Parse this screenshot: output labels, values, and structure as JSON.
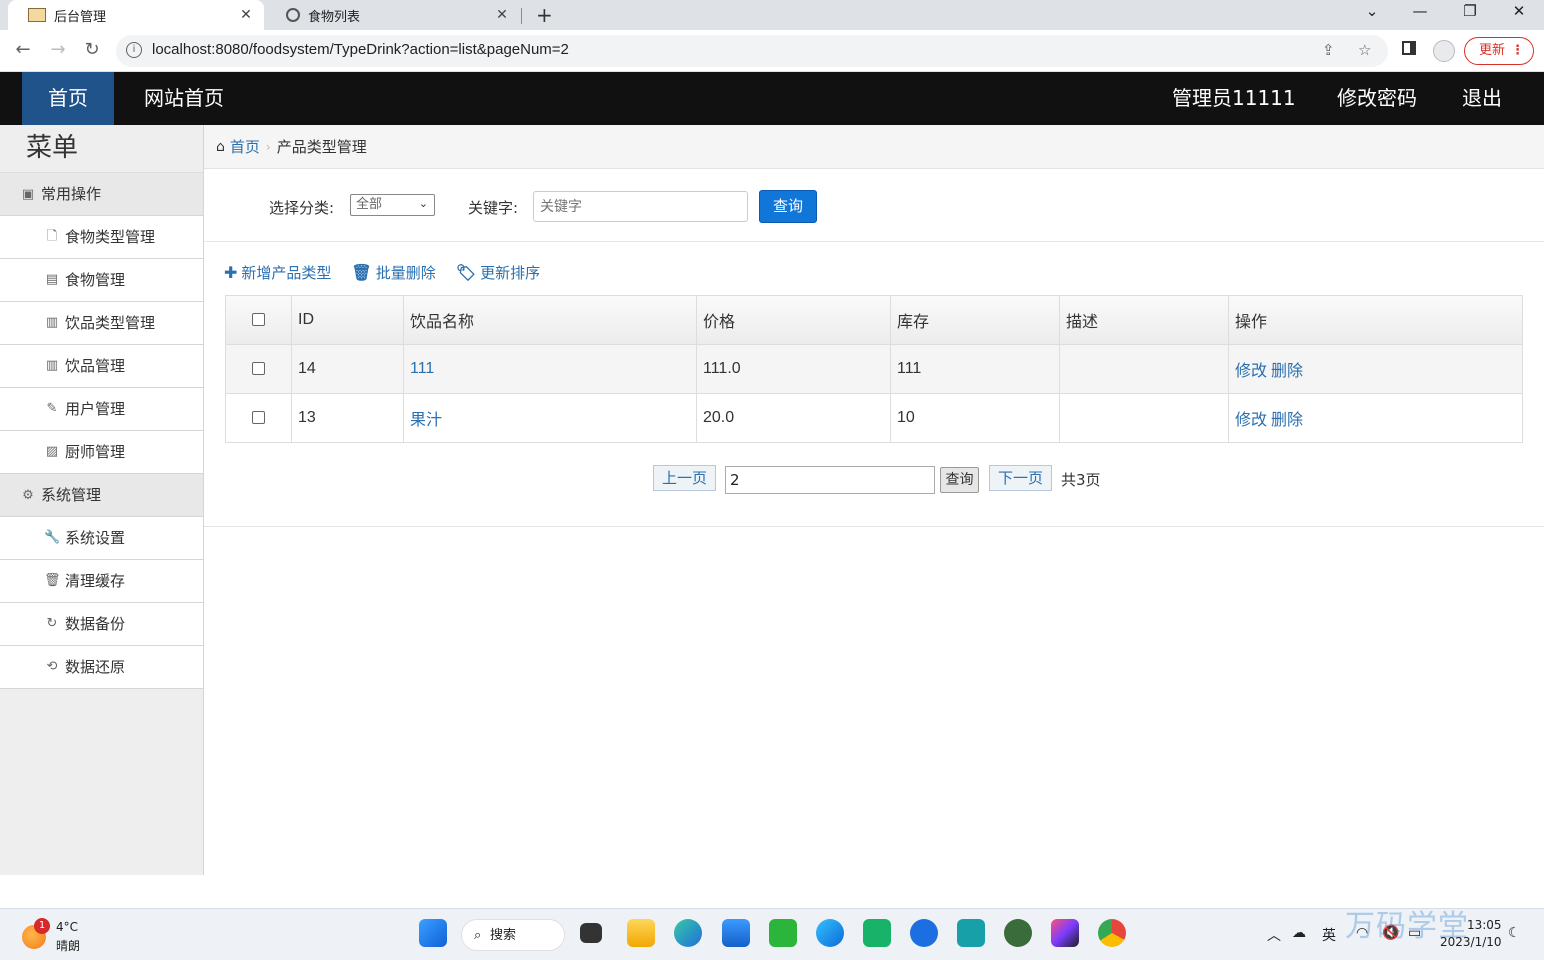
{
  "browser": {
    "tabs": [
      {
        "title": "后台管理",
        "active": true
      },
      {
        "title": "食物列表",
        "active": false
      }
    ],
    "url": "localhost:8080/foodsystem/TypeDrink?action=list&pageNum=2",
    "update_label": "更新"
  },
  "header": {
    "home": "首页",
    "site_home": "网站首页",
    "admin": "管理员11111",
    "change_password": "修改密码",
    "logout": "退出"
  },
  "sidebar": {
    "title": "菜单",
    "groups": [
      {
        "label": "常用操作",
        "icon": "user-card-icon",
        "items": [
          {
            "label": "食物类型管理",
            "icon": "file-icon"
          },
          {
            "label": "食物管理",
            "icon": "list-icon"
          },
          {
            "label": "饮品类型管理",
            "icon": "books-icon"
          },
          {
            "label": "饮品管理",
            "icon": "books-icon"
          },
          {
            "label": "用户管理",
            "icon": "pencil-icon"
          },
          {
            "label": "厨师管理",
            "icon": "picture-icon"
          }
        ]
      },
      {
        "label": "系统管理",
        "icon": "gear-icon",
        "items": [
          {
            "label": "系统设置",
            "icon": "wrench-icon"
          },
          {
            "label": "清理缓存",
            "icon": "trash-icon"
          },
          {
            "label": "数据备份",
            "icon": "refresh-icon"
          },
          {
            "label": "数据还原",
            "icon": "sync-icon"
          }
        ]
      }
    ]
  },
  "breadcrumb": {
    "home": "首页",
    "current": "产品类型管理"
  },
  "search": {
    "category_label": "选择分类:",
    "category_value": "全部",
    "keyword_label": "关键字:",
    "keyword_placeholder": "关键字",
    "query_label": "查询"
  },
  "actions": {
    "add": "新增产品类型",
    "batch_delete": "批量删除",
    "update_sort": "更新排序"
  },
  "table": {
    "columns": [
      "ID",
      "饮品名称",
      "价格",
      "库存",
      "描述",
      "操作"
    ],
    "rows": [
      {
        "id": "14",
        "name": "111",
        "price": "111.0",
        "stock": "111",
        "desc": "",
        "edit": "修改",
        "delete": "删除"
      },
      {
        "id": "13",
        "name": "果汁",
        "price": "20.0",
        "stock": "10",
        "desc": "",
        "edit": "修改",
        "delete": "删除"
      }
    ]
  },
  "pager": {
    "prev": "上一页",
    "page_value": "2",
    "go": "查询",
    "next": "下一页",
    "total": "共3页"
  },
  "taskbar": {
    "temperature": "4°C",
    "condition": "晴朗",
    "weather_badge": "1",
    "search": "搜索",
    "ime": "英",
    "time": "13:05",
    "date": "2023/1/10",
    "watermark": "万码学堂"
  }
}
